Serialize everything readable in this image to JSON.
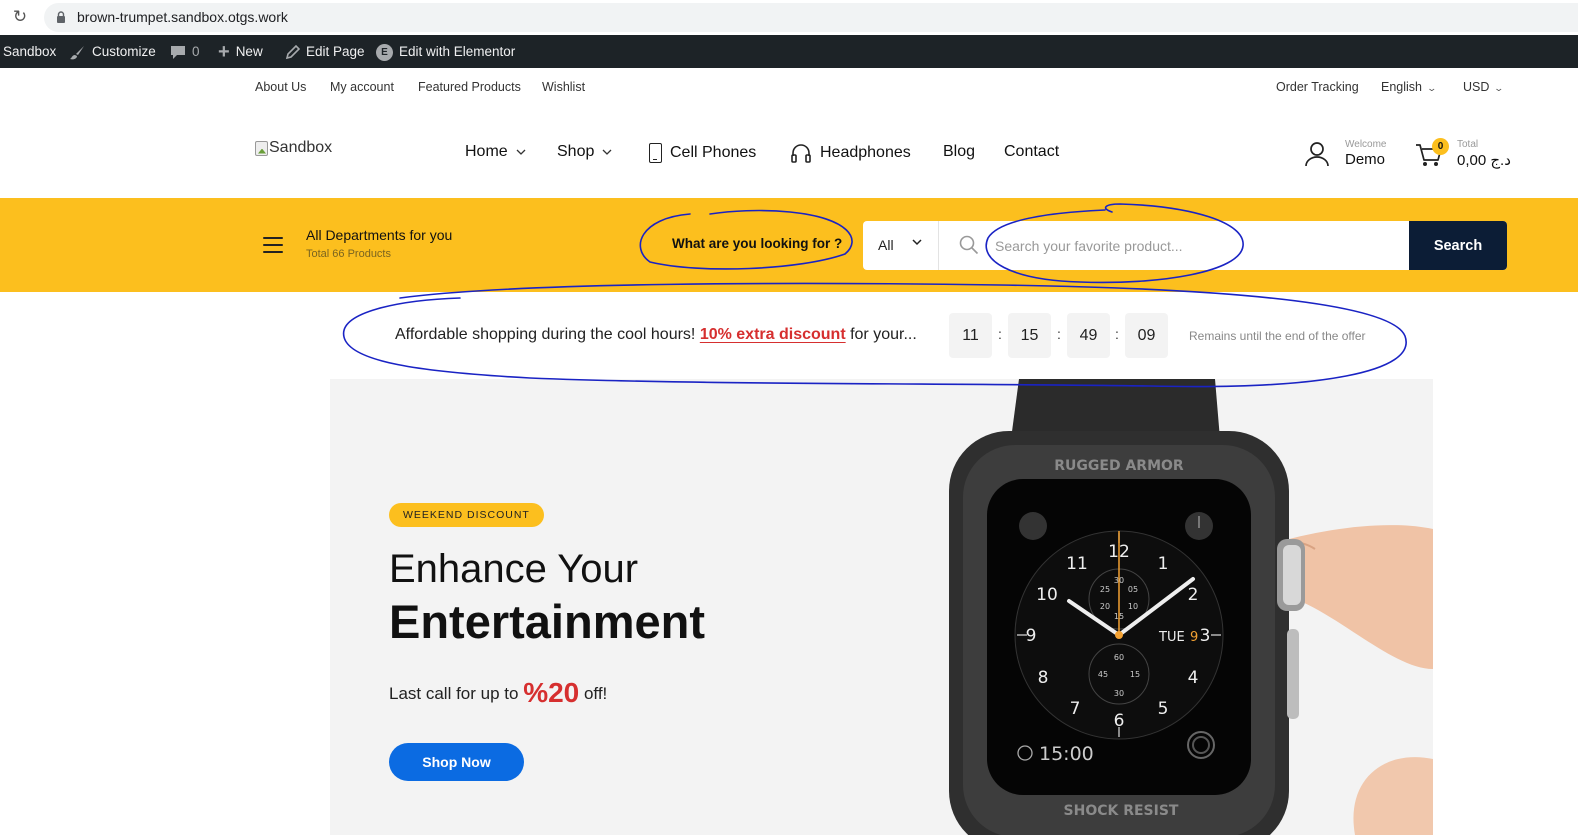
{
  "browser": {
    "url": "brown-trumpet.sandbox.otgs.work"
  },
  "admin_bar": {
    "site": "Sandbox",
    "customize": "Customize",
    "comments_count": "0",
    "new": "New",
    "edit_page": "Edit Page",
    "edit_elementor": "Edit with Elementor"
  },
  "top_links": {
    "about": "About Us",
    "account": "My account",
    "featured": "Featured Products",
    "wishlist": "Wishlist",
    "order_tracking": "Order Tracking",
    "language": "English",
    "currency": "USD"
  },
  "header": {
    "logo_alt": "Sandbox",
    "nav": {
      "home": "Home",
      "shop": "Shop",
      "cell_phones": "Cell Phones",
      "headphones": "Headphones",
      "blog": "Blog",
      "contact": "Contact"
    },
    "welcome_label": "Welcome",
    "user_name": "Demo",
    "cart_count": "0",
    "total_label": "Total",
    "total_value": "0,00 د.ج"
  },
  "search_band": {
    "departments_title": "All Departments for you",
    "departments_sub": "Total 66 Products",
    "looking_for": "What are you looking for ?",
    "category_selected": "All",
    "placeholder": "Search your favorite product...",
    "button": "Search"
  },
  "promo": {
    "text_before": "Affordable shopping during the cool hours! ",
    "discount": "10% extra discount",
    "text_after": " for your...",
    "countdown": {
      "hours": "11",
      "minutes": "15",
      "seconds": "49",
      "frames": "09",
      "sep": ":"
    },
    "remains": "Remains until the end of the offer"
  },
  "hero": {
    "badge": "WEEKEND DISCOUNT",
    "title_line1": "Enhance Your",
    "title_line2": "Entertainment",
    "sub_before": "Last call for up to ",
    "sub_highlight": "%20",
    "sub_after": " off!",
    "button": "Shop Now",
    "watch_text": {
      "top": "RUGGED ARMOR",
      "bottom": "SHOCK RESIST",
      "time": "15:00",
      "date": "TUE",
      "date_num": "9"
    }
  },
  "colors": {
    "accent_yellow": "#fcbf1e",
    "navy": "#0c1d36",
    "red": "#d62f2f",
    "blue_button": "#0b6be2",
    "annotation_ink": "#1a23c4"
  }
}
